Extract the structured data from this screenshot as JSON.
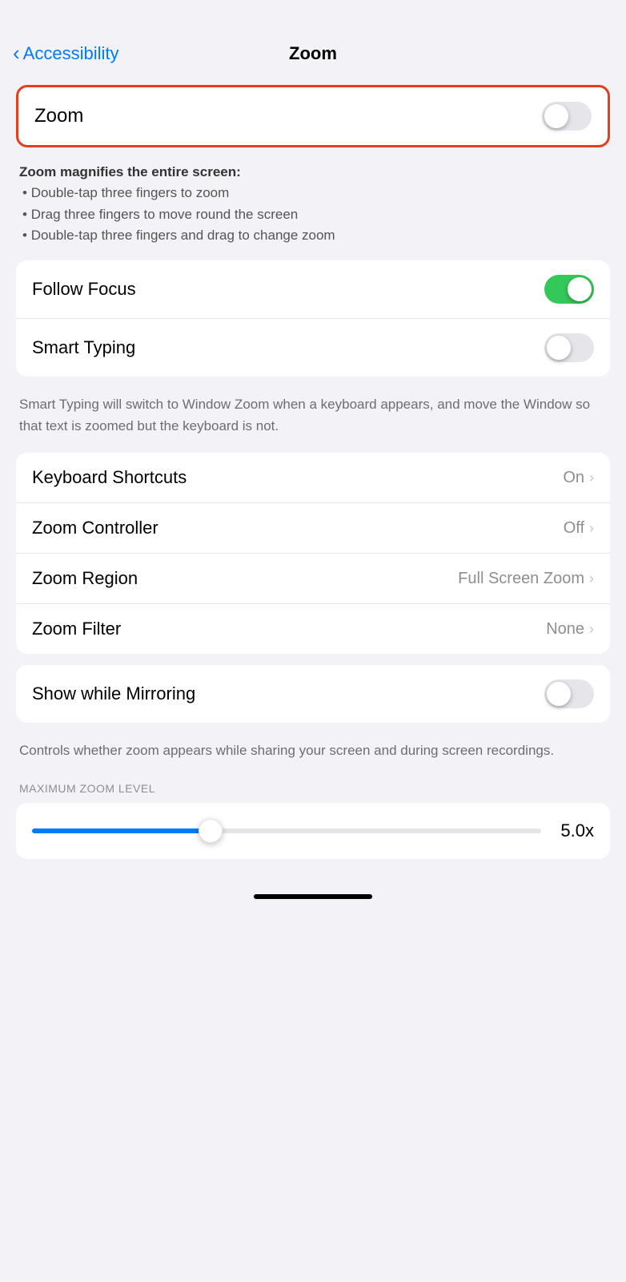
{
  "header": {
    "back_label": "Accessibility",
    "title": "Zoom"
  },
  "zoom_toggle": {
    "label": "Zoom",
    "state": "off"
  },
  "zoom_description": {
    "bold_line": "Zoom magnifies the entire screen:",
    "bullets": [
      "Double-tap three fingers to zoom",
      "Drag three fingers to move round the screen",
      "Double-tap three fingers and drag to change zoom"
    ]
  },
  "focus_card": {
    "rows": [
      {
        "label": "Follow Focus",
        "type": "toggle",
        "state": "on"
      },
      {
        "label": "Smart Typing",
        "type": "toggle",
        "state": "off"
      }
    ]
  },
  "smart_typing_description": "Smart Typing will switch to Window Zoom when a keyboard appears, and move the Window so that text is zoomed but the keyboard is not.",
  "options_card": {
    "rows": [
      {
        "label": "Keyboard Shortcuts",
        "value": "On",
        "type": "link"
      },
      {
        "label": "Zoom Controller",
        "value": "Off",
        "type": "link"
      },
      {
        "label": "Zoom Region",
        "value": "Full Screen Zoom",
        "type": "link"
      },
      {
        "label": "Zoom Filter",
        "value": "None",
        "type": "link"
      }
    ]
  },
  "mirroring_card": {
    "label": "Show while Mirroring",
    "state": "off"
  },
  "mirroring_description": "Controls whether zoom appears while sharing your screen and during screen recordings.",
  "max_zoom_section": {
    "label": "MAXIMUM ZOOM LEVEL"
  },
  "zoom_slider": {
    "value": "5.0x",
    "fill_percent": 35
  },
  "icons": {
    "chevron_left": "‹",
    "chevron_right": "›"
  }
}
